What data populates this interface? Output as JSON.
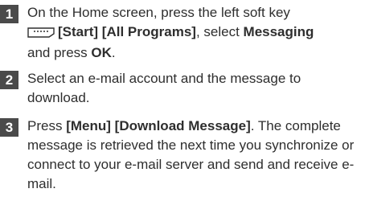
{
  "steps": [
    {
      "number": "1",
      "line1": "On the Home screen, press the left soft key",
      "softkey_icon": "left-softkey-icon",
      "start": "[Start]",
      "all_programs": "[All Programs]",
      "select_text": ", select",
      "messaging": "Messaging",
      "and_press": "and press",
      "ok": "OK",
      "end": "."
    },
    {
      "number": "2",
      "text": "Select an e-mail account and the message to download."
    },
    {
      "number": "3",
      "press": "Press",
      "menu": "[Menu]",
      "download_message": "[Download Message]",
      "rest": ". The complete message is retrieved the next time you synchronize or connect to your e-mail server and send and receive e-mail."
    }
  ]
}
